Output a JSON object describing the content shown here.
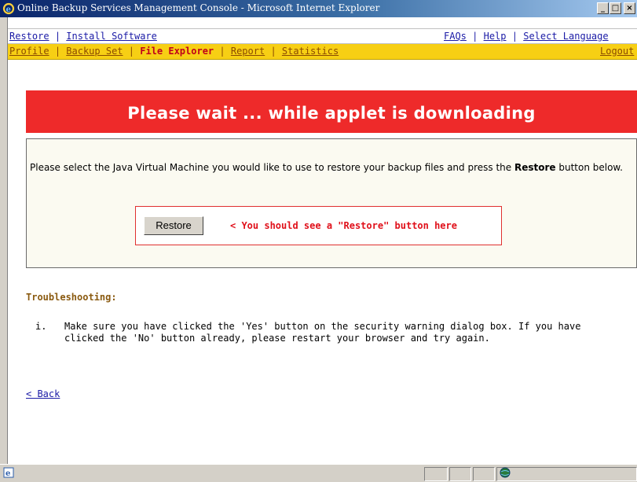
{
  "window": {
    "title": "Online Backup Services Management Console - Microsoft Internet Explorer",
    "minimize_label": "_",
    "maximize_label": "□",
    "close_label": "×"
  },
  "nav_top": {
    "left_links": [
      "Restore",
      "Install Software"
    ],
    "right_links": [
      "FAQs",
      "Help",
      "Select Language"
    ],
    "separator": "|"
  },
  "nav_main": {
    "items": [
      "Profile",
      "Backup Set",
      "File Explorer",
      "Report",
      "Statistics"
    ],
    "active": "File Explorer",
    "logout_label": "Logout",
    "separator": "|"
  },
  "banner": {
    "text": "Please wait ... while applet is downloading"
  },
  "applet": {
    "instruction_pre": "Please select the Java Virtual Machine you would like to use to restore your backup files and press the",
    "instruction_bold": "Restore",
    "instruction_post": " button below.",
    "restore_button_label": "Restore",
    "hint": "< You should see a \"Restore\" button here"
  },
  "troubleshooting": {
    "heading": "Troubleshooting:",
    "items": [
      {
        "num": "i.",
        "text": "Make sure you have clicked the 'Yes' button on the security warning dialog box. If you have clicked the 'No' button already, please restart your browser and try again."
      }
    ]
  },
  "back_link": "< Back",
  "colors": {
    "banner_red": "#ee2a2a",
    "nav_yellow": "#f7cf14",
    "link_blue": "#1a1aa6",
    "active_red": "#c0001a",
    "hint_red": "#e0101a",
    "heading_brown": "#8a5a10"
  },
  "icons": {
    "title_icon": "ie-icon",
    "status_icon": "ie-page-icon",
    "zone_icon": "internet-globe-icon"
  }
}
